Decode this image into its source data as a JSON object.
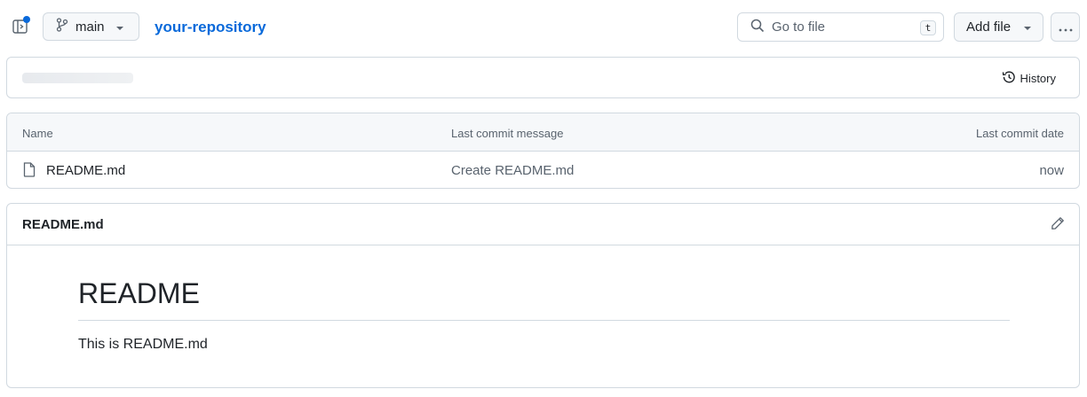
{
  "topbar": {
    "branch": "main",
    "repo_name": "your-repository",
    "search_placeholder": "Go to file",
    "search_shortcut": "t",
    "add_file_label": "Add file"
  },
  "breadcrumb_bar": {
    "history_label": "History"
  },
  "files_table": {
    "columns": [
      "Name",
      "Last commit message",
      "Last commit date"
    ],
    "rows": [
      {
        "name": "README.md",
        "message": "Create README.md",
        "date": "now"
      }
    ]
  },
  "readme": {
    "filename": "README.md",
    "heading": "README",
    "paragraph": "This is README.md"
  },
  "colors": {
    "accent": "#0969da",
    "border": "#d1d9e0",
    "muted_text": "#59636e",
    "header_bg": "#f6f8fa"
  },
  "icons": [
    "sidebar-toggle-icon",
    "git-branch-icon",
    "chevron-down-icon",
    "search-icon",
    "kebab-horizontal-icon",
    "history-icon",
    "file-icon",
    "pencil-icon"
  ]
}
